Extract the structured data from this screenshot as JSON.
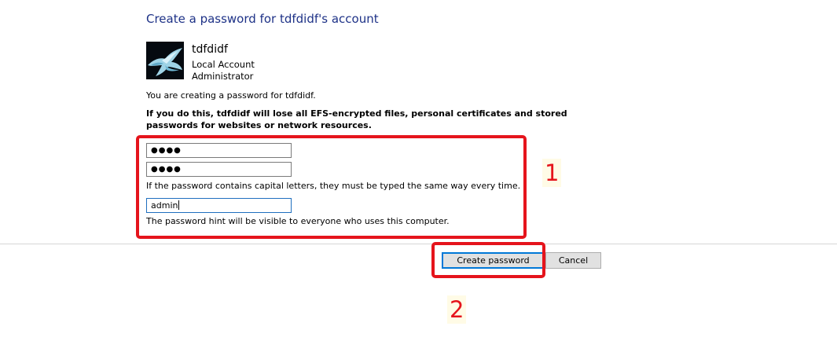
{
  "page": {
    "title": "Create a password for tdfdidf's account"
  },
  "account": {
    "name": "tdfdidf",
    "type": "Local Account",
    "role": "Administrator",
    "avatar_icon": "bird-image"
  },
  "info": {
    "creating_text": "You are creating a password for tdfdidf.",
    "warning_text": "If you do this, tdfdidf will lose all EFS-encrypted files, personal certificates and stored passwords for websites or network resources."
  },
  "form": {
    "new_password_value": "●●●●",
    "confirm_password_value": "●●●●",
    "capital_letters_note": "If the password contains capital letters, they must be typed the same way every time.",
    "hint_value": "admin",
    "hint_note": "The password hint will be visible to everyone who uses this computer."
  },
  "buttons": {
    "create_label": "Create password",
    "cancel_label": "Cancel"
  },
  "annotations": {
    "step1": "1",
    "step2": "2",
    "color": "#e5141c"
  }
}
